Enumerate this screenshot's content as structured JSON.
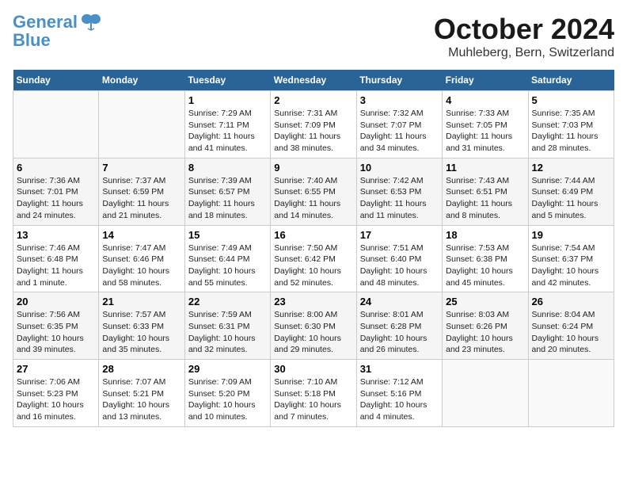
{
  "logo": {
    "line1": "General",
    "line2": "Blue"
  },
  "title": "October 2024",
  "location": "Muhleberg, Bern, Switzerland",
  "days_header": [
    "Sunday",
    "Monday",
    "Tuesday",
    "Wednesday",
    "Thursday",
    "Friday",
    "Saturday"
  ],
  "weeks": [
    [
      {
        "day": "",
        "info": ""
      },
      {
        "day": "",
        "info": ""
      },
      {
        "day": "1",
        "info": "Sunrise: 7:29 AM\nSunset: 7:11 PM\nDaylight: 11 hours and 41 minutes."
      },
      {
        "day": "2",
        "info": "Sunrise: 7:31 AM\nSunset: 7:09 PM\nDaylight: 11 hours and 38 minutes."
      },
      {
        "day": "3",
        "info": "Sunrise: 7:32 AM\nSunset: 7:07 PM\nDaylight: 11 hours and 34 minutes."
      },
      {
        "day": "4",
        "info": "Sunrise: 7:33 AM\nSunset: 7:05 PM\nDaylight: 11 hours and 31 minutes."
      },
      {
        "day": "5",
        "info": "Sunrise: 7:35 AM\nSunset: 7:03 PM\nDaylight: 11 hours and 28 minutes."
      }
    ],
    [
      {
        "day": "6",
        "info": "Sunrise: 7:36 AM\nSunset: 7:01 PM\nDaylight: 11 hours and 24 minutes."
      },
      {
        "day": "7",
        "info": "Sunrise: 7:37 AM\nSunset: 6:59 PM\nDaylight: 11 hours and 21 minutes."
      },
      {
        "day": "8",
        "info": "Sunrise: 7:39 AM\nSunset: 6:57 PM\nDaylight: 11 hours and 18 minutes."
      },
      {
        "day": "9",
        "info": "Sunrise: 7:40 AM\nSunset: 6:55 PM\nDaylight: 11 hours and 14 minutes."
      },
      {
        "day": "10",
        "info": "Sunrise: 7:42 AM\nSunset: 6:53 PM\nDaylight: 11 hours and 11 minutes."
      },
      {
        "day": "11",
        "info": "Sunrise: 7:43 AM\nSunset: 6:51 PM\nDaylight: 11 hours and 8 minutes."
      },
      {
        "day": "12",
        "info": "Sunrise: 7:44 AM\nSunset: 6:49 PM\nDaylight: 11 hours and 5 minutes."
      }
    ],
    [
      {
        "day": "13",
        "info": "Sunrise: 7:46 AM\nSunset: 6:48 PM\nDaylight: 11 hours and 1 minute."
      },
      {
        "day": "14",
        "info": "Sunrise: 7:47 AM\nSunset: 6:46 PM\nDaylight: 10 hours and 58 minutes."
      },
      {
        "day": "15",
        "info": "Sunrise: 7:49 AM\nSunset: 6:44 PM\nDaylight: 10 hours and 55 minutes."
      },
      {
        "day": "16",
        "info": "Sunrise: 7:50 AM\nSunset: 6:42 PM\nDaylight: 10 hours and 52 minutes."
      },
      {
        "day": "17",
        "info": "Sunrise: 7:51 AM\nSunset: 6:40 PM\nDaylight: 10 hours and 48 minutes."
      },
      {
        "day": "18",
        "info": "Sunrise: 7:53 AM\nSunset: 6:38 PM\nDaylight: 10 hours and 45 minutes."
      },
      {
        "day": "19",
        "info": "Sunrise: 7:54 AM\nSunset: 6:37 PM\nDaylight: 10 hours and 42 minutes."
      }
    ],
    [
      {
        "day": "20",
        "info": "Sunrise: 7:56 AM\nSunset: 6:35 PM\nDaylight: 10 hours and 39 minutes."
      },
      {
        "day": "21",
        "info": "Sunrise: 7:57 AM\nSunset: 6:33 PM\nDaylight: 10 hours and 35 minutes."
      },
      {
        "day": "22",
        "info": "Sunrise: 7:59 AM\nSunset: 6:31 PM\nDaylight: 10 hours and 32 minutes."
      },
      {
        "day": "23",
        "info": "Sunrise: 8:00 AM\nSunset: 6:30 PM\nDaylight: 10 hours and 29 minutes."
      },
      {
        "day": "24",
        "info": "Sunrise: 8:01 AM\nSunset: 6:28 PM\nDaylight: 10 hours and 26 minutes."
      },
      {
        "day": "25",
        "info": "Sunrise: 8:03 AM\nSunset: 6:26 PM\nDaylight: 10 hours and 23 minutes."
      },
      {
        "day": "26",
        "info": "Sunrise: 8:04 AM\nSunset: 6:24 PM\nDaylight: 10 hours and 20 minutes."
      }
    ],
    [
      {
        "day": "27",
        "info": "Sunrise: 7:06 AM\nSunset: 5:23 PM\nDaylight: 10 hours and 16 minutes."
      },
      {
        "day": "28",
        "info": "Sunrise: 7:07 AM\nSunset: 5:21 PM\nDaylight: 10 hours and 13 minutes."
      },
      {
        "day": "29",
        "info": "Sunrise: 7:09 AM\nSunset: 5:20 PM\nDaylight: 10 hours and 10 minutes."
      },
      {
        "day": "30",
        "info": "Sunrise: 7:10 AM\nSunset: 5:18 PM\nDaylight: 10 hours and 7 minutes."
      },
      {
        "day": "31",
        "info": "Sunrise: 7:12 AM\nSunset: 5:16 PM\nDaylight: 10 hours and 4 minutes."
      },
      {
        "day": "",
        "info": ""
      },
      {
        "day": "",
        "info": ""
      }
    ]
  ]
}
